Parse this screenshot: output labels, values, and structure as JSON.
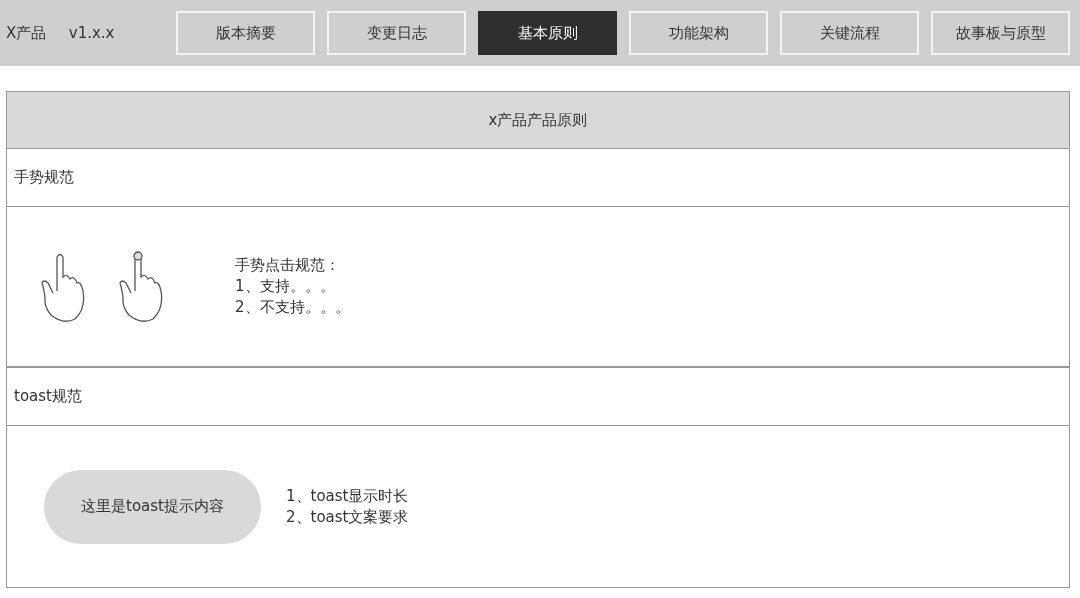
{
  "header": {
    "product": "X产品",
    "version": "v1.x.x"
  },
  "tabs": [
    {
      "label": "版本摘要",
      "selected": false
    },
    {
      "label": "变更日志",
      "selected": false
    },
    {
      "label": "基本原则",
      "selected": true
    },
    {
      "label": "功能架构",
      "selected": false
    },
    {
      "label": "关键流程",
      "selected": false
    },
    {
      "label": "故事板与原型",
      "selected": false
    }
  ],
  "page_title": "x产品产品原则",
  "sections": [
    {
      "title": "手势规范",
      "kind": "gesture",
      "lines": [
        "手势点击规范：",
        "1、支持。。。",
        "2、不支持。。。"
      ]
    },
    {
      "title": "toast规范",
      "kind": "toast",
      "toast_text": "这里是toast提示内容",
      "lines": [
        "1、toast显示时长",
        "2、toast文案要求"
      ]
    }
  ]
}
